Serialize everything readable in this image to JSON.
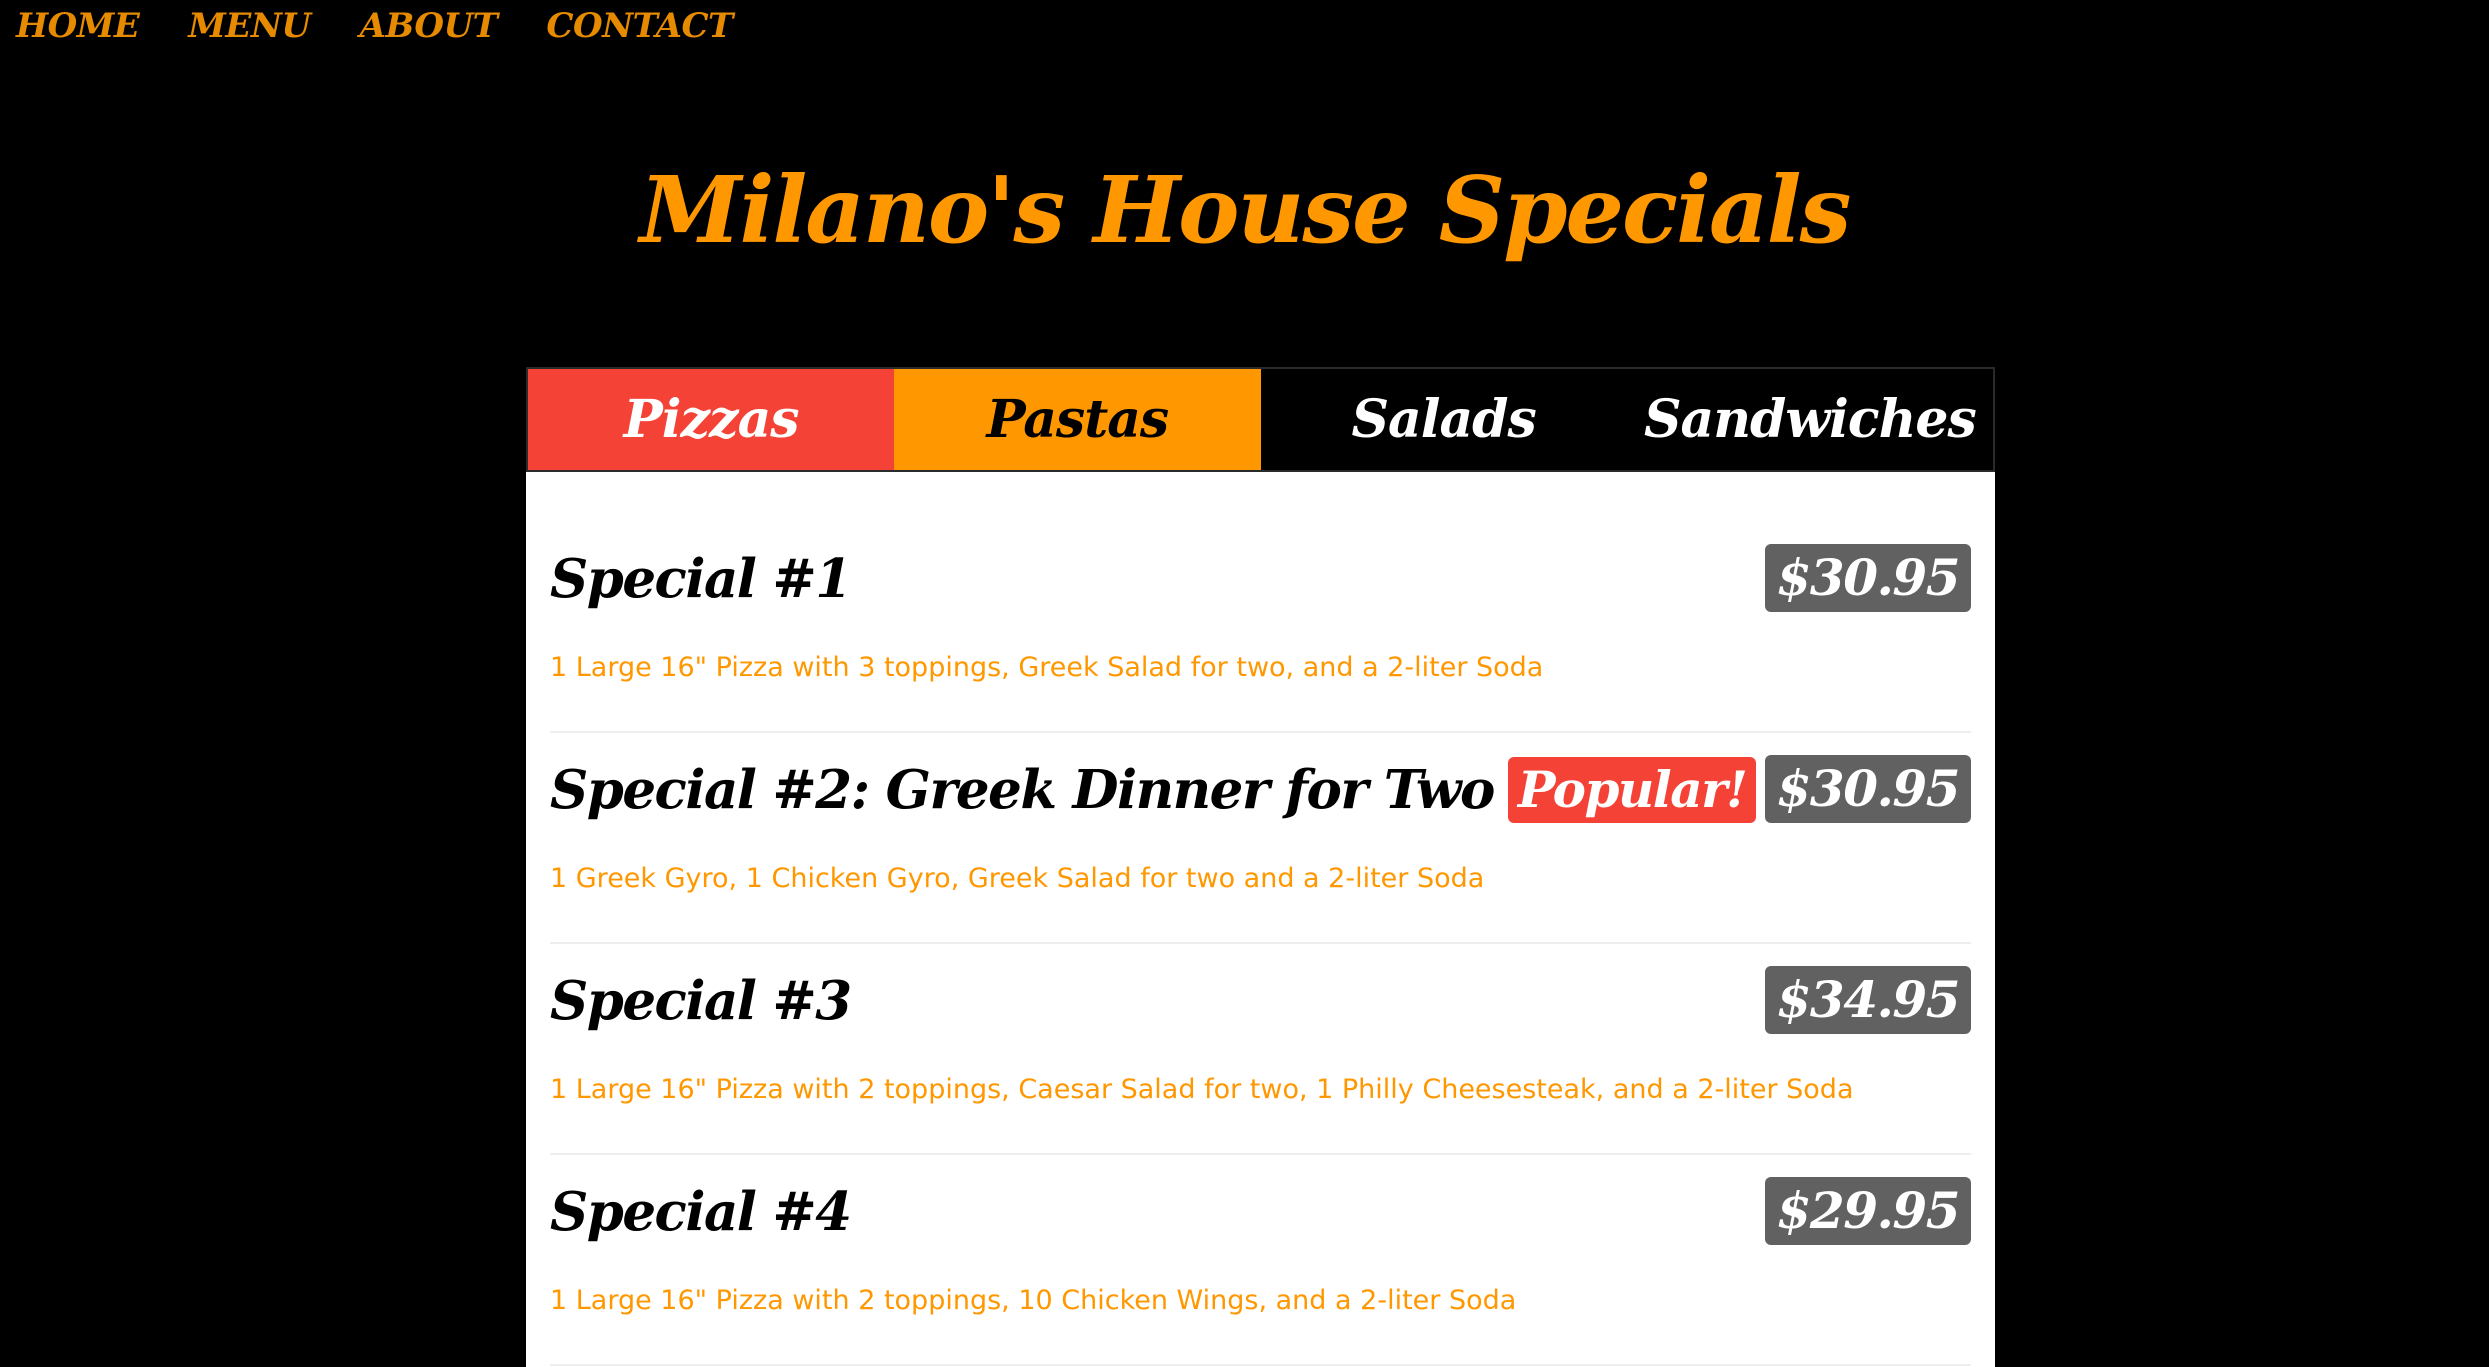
{
  "nav": {
    "items": [
      "HOME",
      "MENU",
      "ABOUT",
      "CONTACT"
    ]
  },
  "page": {
    "title": "Milano's House Specials"
  },
  "tabs": [
    "Pizzas",
    "Pastas",
    "Salads",
    "Sandwiches"
  ],
  "specials": [
    {
      "name": "Special #1",
      "badge": "",
      "price": "$30.95",
      "description": "1 Large 16\" Pizza with 3 toppings, Greek Salad for two, and a 2-liter Soda"
    },
    {
      "name": "Special #2: Greek Dinner for Two",
      "badge": "Popular!",
      "price": "$30.95",
      "description": "1 Greek Gyro, 1 Chicken Gyro, Greek Salad for two and a 2-liter Soda"
    },
    {
      "name": "Special #3",
      "badge": "",
      "price": "$34.95",
      "description": "1 Large 16\" Pizza with 2 toppings, Caesar Salad for two, 1 Philly Cheesesteak, and a 2-liter Soda"
    },
    {
      "name": "Special #4",
      "badge": "",
      "price": "$29.95",
      "description": "1 Large 16\" Pizza with 2 toppings, 10 Chicken Wings, and a 2-liter Soda"
    }
  ],
  "colors": {
    "background": "#000000",
    "accent_orange": "#ff9800",
    "accent_red": "#f44336",
    "price_badge": "#616161"
  }
}
